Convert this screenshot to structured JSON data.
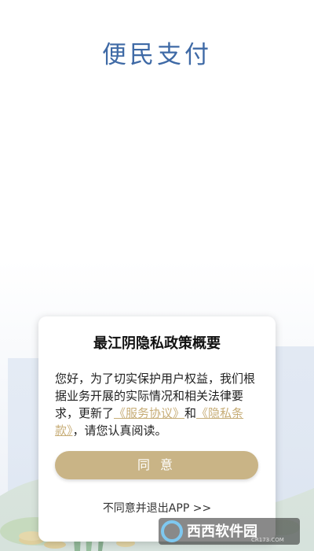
{
  "app": {
    "title": "便民支付"
  },
  "dialog": {
    "title": "最江阴隐私政策概要",
    "body_pre": "您好，为了切实保护用户权益，我们根据业务开展的实际情况和相关法律要求，更新了",
    "link_service": "《服务协议》",
    "body_mid": "和",
    "link_privacy": "《隐私条款》",
    "body_post": "，请您认真阅读。",
    "agree_label": "同 意",
    "disagree_label": "不同意并退出APP >>"
  },
  "watermark": {
    "text": "西西软件园",
    "sub": "CR173.COM"
  },
  "colors": {
    "title": "#3f6aa6",
    "accent": "#c9b486",
    "link": "#c7ad77"
  }
}
